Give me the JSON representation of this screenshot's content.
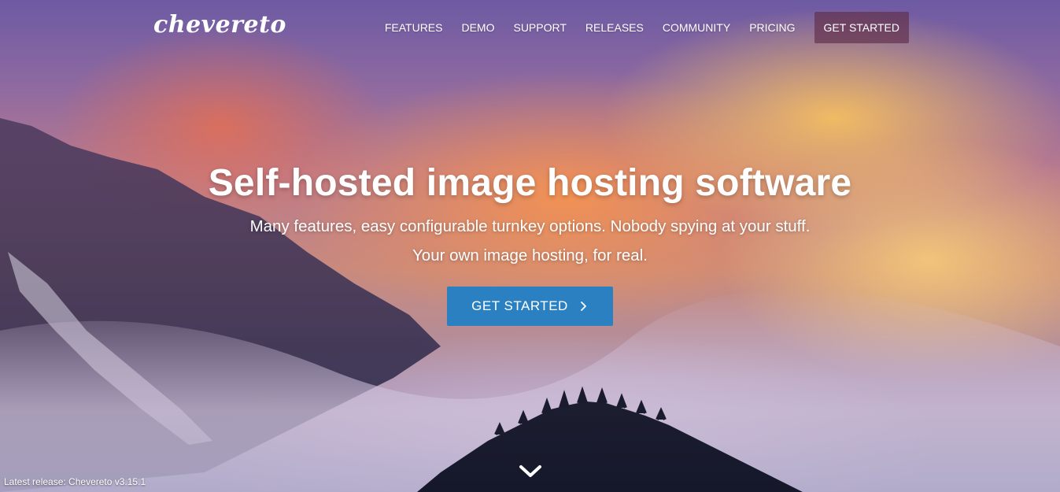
{
  "brand": {
    "logo_text": "chevereto"
  },
  "nav": {
    "items": [
      {
        "label": "FEATURES"
      },
      {
        "label": "DEMO"
      },
      {
        "label": "SUPPORT"
      },
      {
        "label": "RELEASES"
      },
      {
        "label": "COMMUNITY"
      },
      {
        "label": "PRICING"
      }
    ],
    "cta_label": "GET STARTED"
  },
  "hero": {
    "title": "Self-hosted image hosting software",
    "line1": "Many features, easy configurable turnkey options. Nobody spying at your stuff.",
    "line2": "Your own image hosting, for real.",
    "button_label": "GET STARTED",
    "button_icon": "chevron-right-icon"
  },
  "footer": {
    "release_text": "Latest release: Chevereto v3.15.1"
  },
  "scroll_icon": "chevron-down-icon",
  "colors": {
    "cta_blue": "#2a80c0",
    "nav_cta_bg": "#5f2d46",
    "text": "#ffffff"
  }
}
